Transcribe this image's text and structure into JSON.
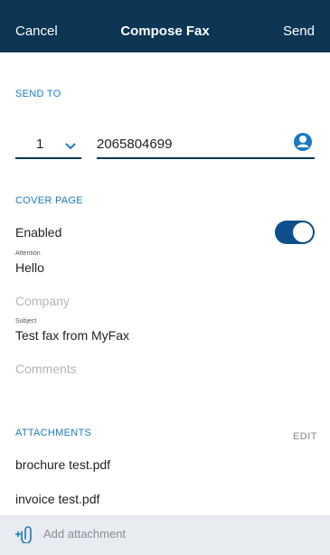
{
  "header": {
    "cancel_label": "Cancel",
    "title": "Compose Fax",
    "send_label": "Send"
  },
  "send_to": {
    "section_label": "SEND TO",
    "country_code": "1",
    "fax_number": "2065804699"
  },
  "cover_page": {
    "section_label": "COVER PAGE",
    "enabled_label": "Enabled",
    "enabled": true,
    "attention_label": "Attention",
    "attention_value": "Hello",
    "company_placeholder": "Company",
    "subject_label": "Subject",
    "subject_value": "Test fax from MyFax",
    "comments_placeholder": "Comments"
  },
  "attachments": {
    "section_label": "ATTACHMENTS",
    "edit_label": "EDIT",
    "files": [
      "brochure test.pdf",
      "invoice test.pdf"
    ],
    "add_label": "Add attachment"
  },
  "colors": {
    "header_bg": "#0d3554",
    "accent": "#1b7ac1",
    "toggle_on": "#0d4f8a"
  },
  "icons": [
    "chevron-down-icon",
    "contact-icon",
    "paperclip-add-icon"
  ]
}
